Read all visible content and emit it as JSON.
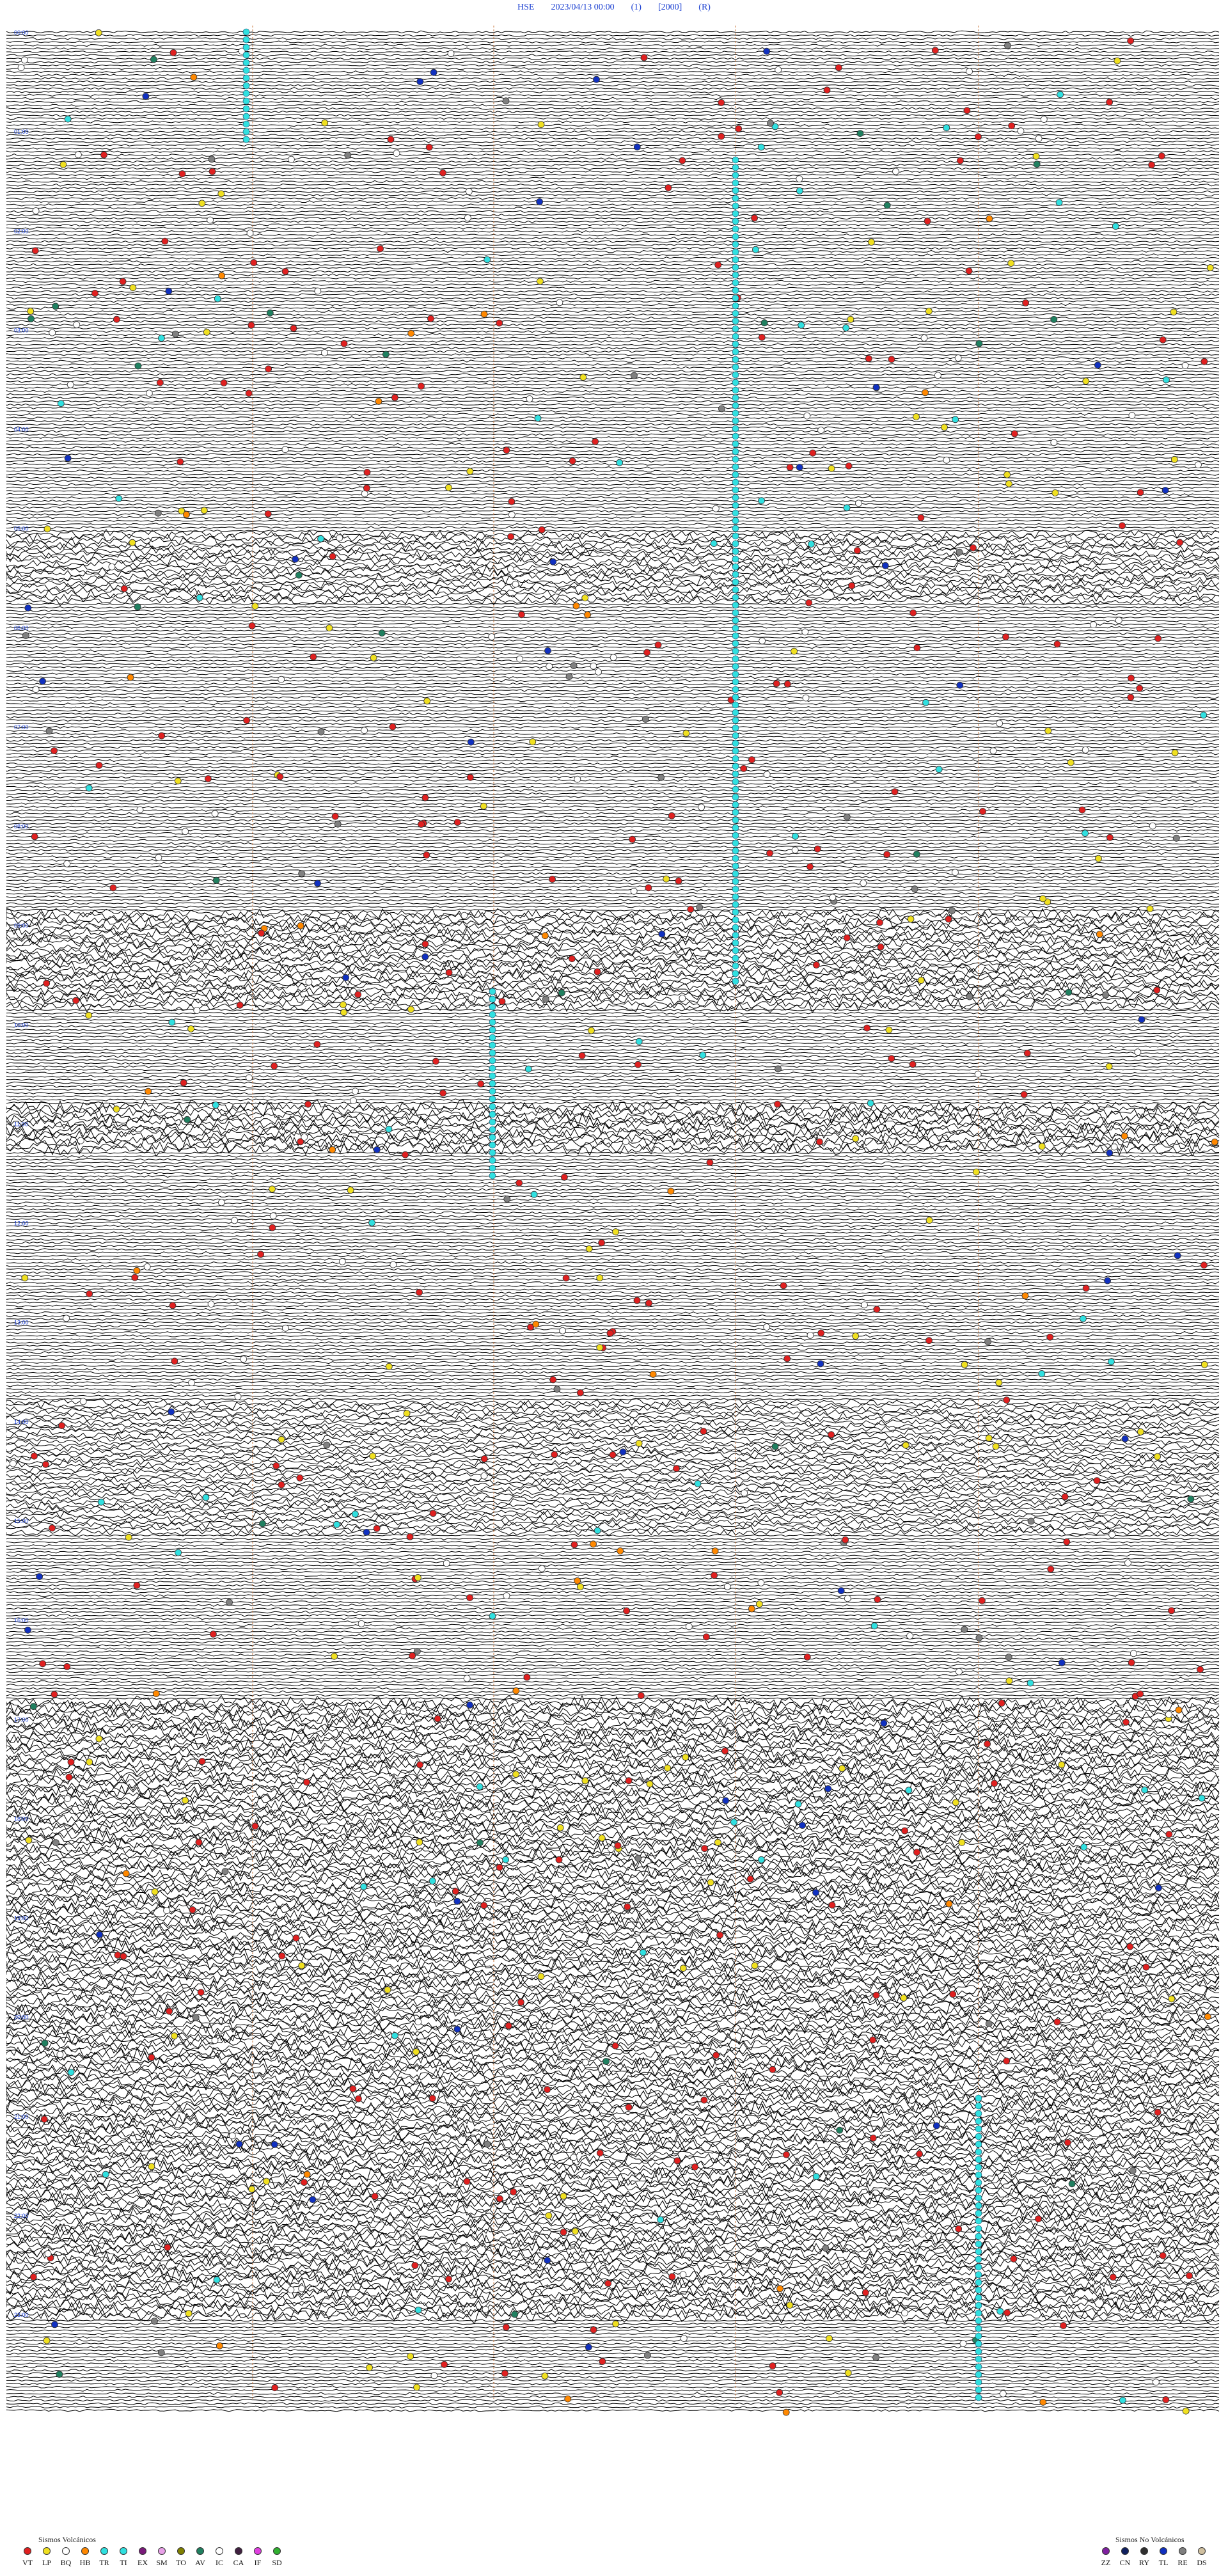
{
  "header": {
    "station": "HSE",
    "datetime": "2023/04/13 00:00",
    "flag1": "(1)",
    "scale": "[2000]",
    "flag2": "(R)"
  },
  "hour_labels": [
    "00:00",
    "01:00",
    "02:00",
    "03:00",
    "04:00",
    "05:00",
    "06:00",
    "07:00",
    "08:00",
    "09:00",
    "10:00",
    "11:00",
    "12:00",
    "13:00",
    "14:00",
    "15:00",
    "16:00",
    "17:00",
    "18:00",
    "19:00",
    "20:00",
    "21:00",
    "22:00",
    "23:00"
  ],
  "colors": {
    "trace": "#000000",
    "hour_label": "#1a3fd1",
    "minute_marker": "#c8743a",
    "VT": "#e02020",
    "LP": "#f0e020",
    "BQ": "#ffffff",
    "HB": "#ff8800",
    "TR": "#30e0e0",
    "TI": "#30e0e0",
    "EX": "#7a1a7a",
    "SM": "#e8a0e8",
    "TO": "#808000",
    "AV": "#208060",
    "IC": "#ffffff",
    "CA": "#402040",
    "IF": "#e040e0",
    "SD": "#30b030",
    "ZZ": "#8020a0",
    "CN": "#102060",
    "RY": "#303030",
    "TL": "#1030c0",
    "RE": "#808080",
    "DS": "#d0c0a0"
  },
  "legend": {
    "volcanic_title": "Sismos Volcánicos",
    "nonvolcanic_title": "Sismos No Volcánicos",
    "volcanic": [
      {
        "code": "VT",
        "color": "#e02020"
      },
      {
        "code": "LP",
        "color": "#f0e020"
      },
      {
        "code": "BQ",
        "color": "#ffffff"
      },
      {
        "code": "HB",
        "color": "#ff8800"
      },
      {
        "code": "TR",
        "color": "#30e0e0"
      },
      {
        "code": "TI",
        "color": "#30e0e0"
      },
      {
        "code": "EX",
        "color": "#7a1a7a"
      },
      {
        "code": "SM",
        "color": "#e8a0e8"
      },
      {
        "code": "TO",
        "color": "#808000"
      },
      {
        "code": "AV",
        "color": "#208060"
      },
      {
        "code": "IC",
        "color": "#ffffff"
      },
      {
        "code": "CA",
        "color": "#402040"
      },
      {
        "code": "IF",
        "color": "#e040e0"
      },
      {
        "code": "SD",
        "color": "#30b030"
      }
    ],
    "nonvolcanic": [
      {
        "code": "ZZ",
        "color": "#8020a0"
      },
      {
        "code": "CN",
        "color": "#102060"
      },
      {
        "code": "RY",
        "color": "#303030"
      },
      {
        "code": "TL",
        "color": "#1030c0"
      },
      {
        "code": "RE",
        "color": "#808080"
      },
      {
        "code": "DS",
        "color": "#d0c0a0"
      }
    ]
  }
}
